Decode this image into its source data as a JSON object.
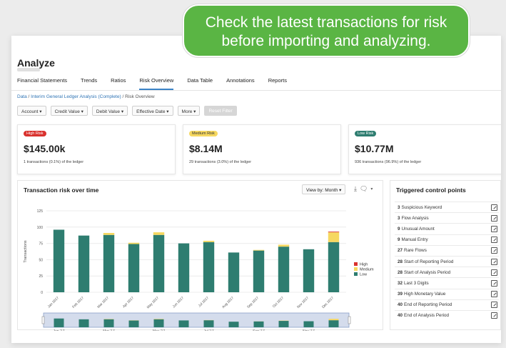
{
  "callout": {
    "line1": "Check the latest transactions for risk",
    "line2": "before importing and analyzing."
  },
  "header": {
    "title": "Analyze"
  },
  "tabs": [
    {
      "label": "Financial Statements"
    },
    {
      "label": "Trends"
    },
    {
      "label": "Ratios"
    },
    {
      "label": "Risk Overview",
      "active": true
    },
    {
      "label": "Data Table"
    },
    {
      "label": "Annotations"
    },
    {
      "label": "Reports"
    }
  ],
  "breadcrumb": {
    "root": "Data",
    "sep": "/",
    "middle": "Interim General Ledger Analysis (Complete)",
    "current": "Risk Overview"
  },
  "filters": [
    {
      "label": "Account ▾"
    },
    {
      "label": "Credit Value ▾"
    },
    {
      "label": "Debit Value ▾"
    },
    {
      "label": "Effective Date ▾"
    },
    {
      "label": "More ▾"
    },
    {
      "label": "Reset Filter",
      "disabled": true
    }
  ],
  "cards": [
    {
      "badge": "High Risk",
      "amount": "$145.00k",
      "sub": "1 transactions (0.1%) of the ledger",
      "badge_bg": "#d9322e",
      "badge_fg": "#ffffff"
    },
    {
      "badge": "Medium Risk",
      "amount": "$8.14M",
      "sub": "29 transactions (3.0%) of the ledger",
      "badge_bg": "#f6d860",
      "badge_fg": "#333333"
    },
    {
      "badge": "Low Risk",
      "amount": "$10.77M",
      "sub": "936 transactions (96.9%) of the ledger",
      "badge_bg": "#2e7d70",
      "badge_fg": "#ffffff"
    }
  ],
  "chart_panel": {
    "title": "Transaction risk over time",
    "view_by": "View by: Month ▾",
    "icons": [
      "download-icon",
      "comment-icon"
    ]
  },
  "chart_data": {
    "type": "bar",
    "stacked": true,
    "ylabel": "Transactions",
    "ylim": [
      0,
      125
    ],
    "yticks": [
      0,
      25,
      50,
      75,
      100,
      125
    ],
    "categories": [
      "Jan 2017",
      "Feb 2017",
      "Mar 2017",
      "Apr 2017",
      "May 2017",
      "Jun 2017",
      "Jul 2017",
      "Aug 2017",
      "Sep 2017",
      "Oct 2017",
      "Nov 2017",
      "Dec 2017"
    ],
    "series": [
      {
        "name": "Low",
        "color": "#2e7d70",
        "values": [
          96,
          87,
          88,
          74,
          88,
          75,
          77,
          61,
          64,
          70,
          66,
          77
        ]
      },
      {
        "name": "Medium",
        "color": "#f6d860",
        "values": [
          0,
          0,
          3,
          2,
          4,
          0,
          2,
          0,
          1,
          3,
          0,
          15
        ]
      },
      {
        "name": "High",
        "color": "#d9322e",
        "values": [
          0,
          0,
          0,
          0,
          0,
          0,
          0,
          0,
          0,
          0,
          0,
          1
        ]
      }
    ],
    "legend_order": [
      "High",
      "Medium",
      "Low"
    ],
    "legend_position": "right",
    "grid": true,
    "navigator_labels": [
      "Jan '17",
      "Mar '17",
      "May '17",
      "Jul '17",
      "Sep '17",
      "Nov '17"
    ]
  },
  "controls": {
    "title": "Triggered control points",
    "items": [
      {
        "count": "3",
        "label": "Suspicious Keyword"
      },
      {
        "count": "3",
        "label": "Flow Analysis"
      },
      {
        "count": "9",
        "label": "Unusual Amount"
      },
      {
        "count": "9",
        "label": "Manual Entry"
      },
      {
        "count": "27",
        "label": "Rare Flows"
      },
      {
        "count": "28",
        "label": "Start of Reporting Period"
      },
      {
        "count": "28",
        "label": "Start of Analysis Period"
      },
      {
        "count": "32",
        "label": "Last 3 Digits"
      },
      {
        "count": "39",
        "label": "High Monetary Value"
      },
      {
        "count": "40",
        "label": "End of Reporting Period"
      },
      {
        "count": "40",
        "label": "End of Analysis Period"
      }
    ]
  }
}
